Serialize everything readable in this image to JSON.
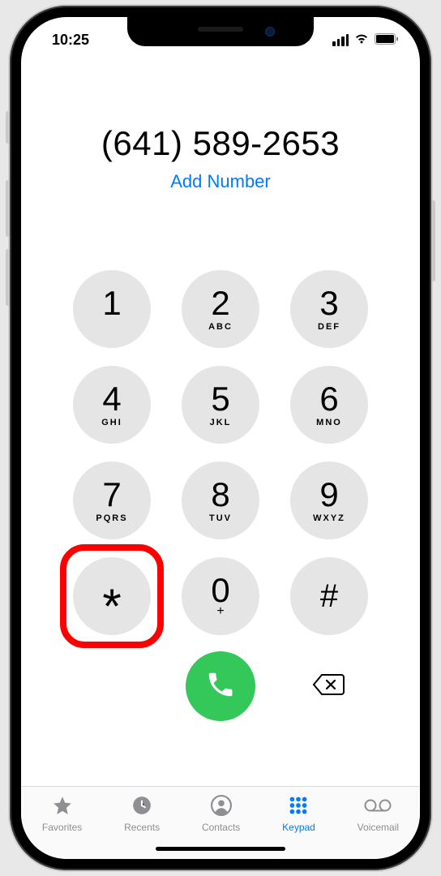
{
  "status": {
    "time": "10:25"
  },
  "display": {
    "phoneNumber": "(641) 589-2653",
    "addNumberLabel": "Add Number"
  },
  "keys": {
    "k1": {
      "digit": "1",
      "letters": ""
    },
    "k2": {
      "digit": "2",
      "letters": "ABC"
    },
    "k3": {
      "digit": "3",
      "letters": "DEF"
    },
    "k4": {
      "digit": "4",
      "letters": "GHI"
    },
    "k5": {
      "digit": "5",
      "letters": "JKL"
    },
    "k6": {
      "digit": "6",
      "letters": "MNO"
    },
    "k7": {
      "digit": "7",
      "letters": "PQRS"
    },
    "k8": {
      "digit": "8",
      "letters": "TUV"
    },
    "k9": {
      "digit": "9",
      "letters": "WXYZ"
    },
    "kstar": {
      "symbol": "*"
    },
    "k0": {
      "digit": "0",
      "sub": "+"
    },
    "khash": {
      "symbol": "#"
    }
  },
  "highlightedKey": "star",
  "tabs": {
    "favorites": "Favorites",
    "recents": "Recents",
    "contacts": "Contacts",
    "keypad": "Keypad",
    "voicemail": "Voicemail",
    "active": "keypad"
  },
  "colors": {
    "accent": "#007aff",
    "callGreen": "#34c759",
    "keyGray": "#e5e5e5",
    "highlightRed": "#ff0000"
  }
}
